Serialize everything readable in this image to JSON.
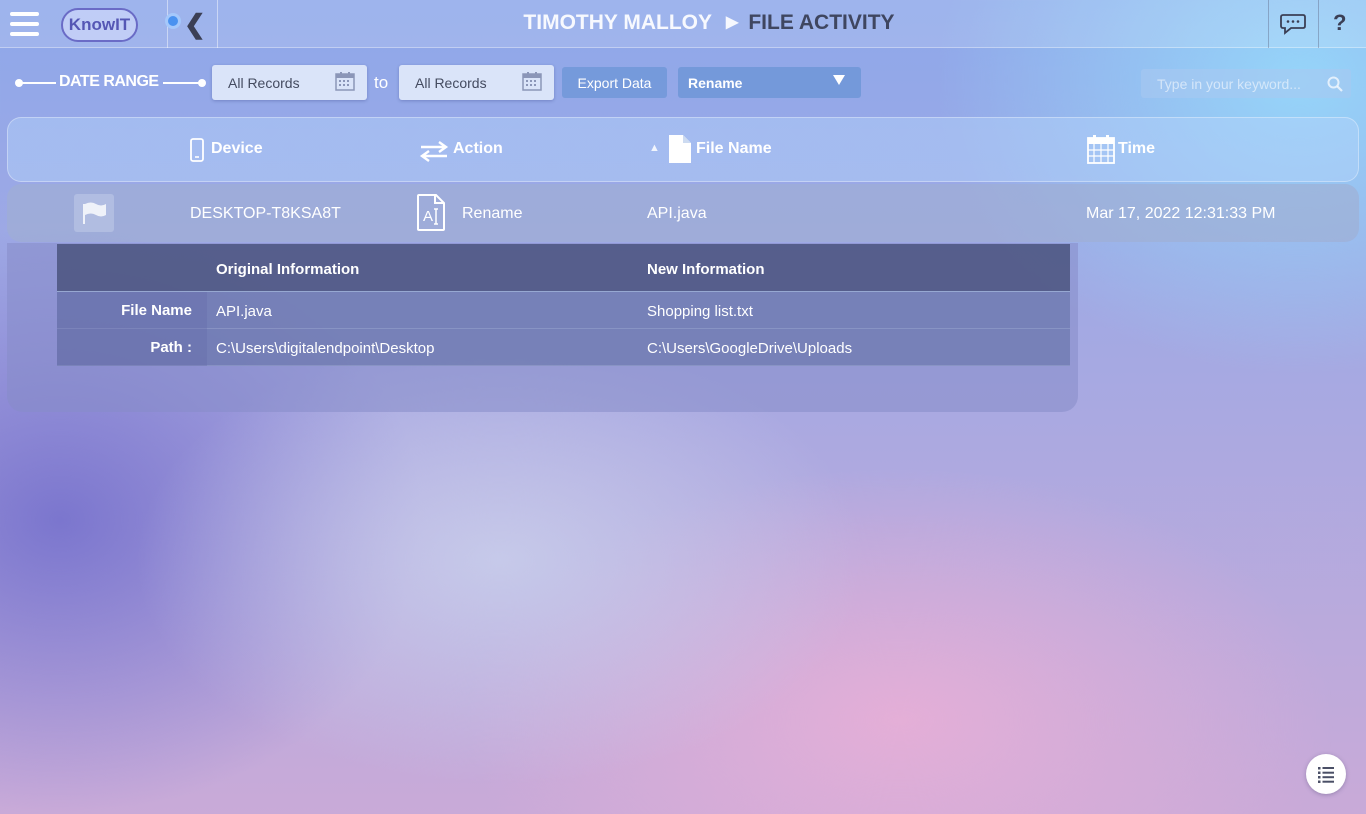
{
  "header": {
    "logo_text": "KnowIT",
    "user_name": "TIMOTHY MALLOY",
    "page_name": "FILE ACTIVITY"
  },
  "filters": {
    "date_range_label": "DATE RANGE",
    "from_value": "All Records",
    "to_label": "to",
    "to_value": "All Records",
    "export_label": "Export Data",
    "action_selected": "Rename",
    "search_placeholder": "Type in your keyword..."
  },
  "table": {
    "columns": [
      "Device",
      "Action",
      "File Name",
      "Time"
    ],
    "sort_column": "File Name",
    "rows": [
      {
        "device": "DESKTOP-T8KSA8T",
        "action": "Rename",
        "file_name": "API.java",
        "time": "Mar 17, 2022 12:31:33 PM"
      }
    ]
  },
  "details": {
    "original_header": "Original Information",
    "new_header": "New Information",
    "rows": [
      {
        "label": "File Name",
        "original": "API.java",
        "new": "Shopping list.txt"
      },
      {
        "label": "Path :",
        "original": "C:\\Users\\digitalendpoint\\Desktop",
        "new": "C:\\Users\\GoogleDrive\\Uploads"
      }
    ]
  },
  "icons": {
    "menu": "hamburger-icon",
    "back": "chevron-left-icon",
    "chat": "chat-icon",
    "help": "help-icon",
    "list": "list-icon"
  },
  "colors": {
    "accent": "#4a92f0",
    "title_dark": "#3f4660",
    "button_blue": "#6e96d7"
  }
}
